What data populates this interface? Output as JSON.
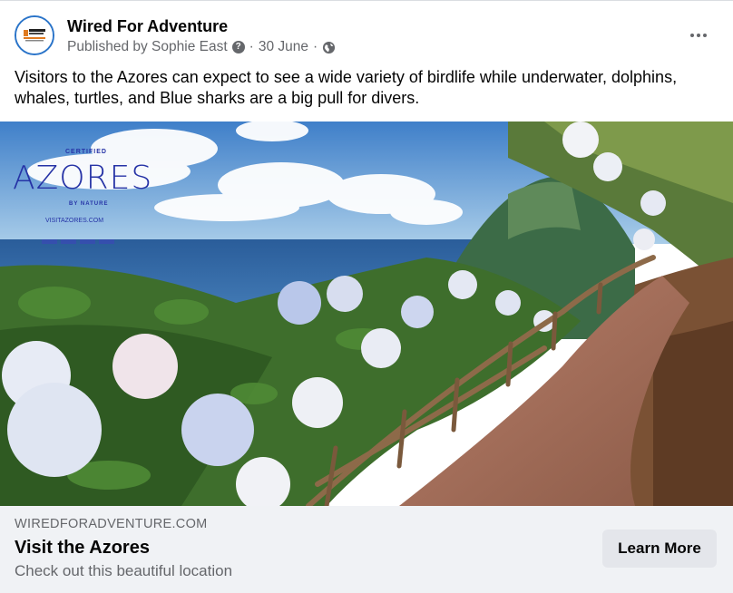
{
  "post": {
    "page_name": "Wired For Adventure",
    "published_by": "Published by Sophie East",
    "separator": "·",
    "date": "30 June",
    "caption": "Visitors to the Azores can expect to see a wide variety of birdlife while underwater, dolphins, whales, turtles, and Blue sharks are a big pull for divers.",
    "icons": {
      "help": "question-circle-icon",
      "privacy": "globe-icon",
      "more": "more-horizontal-icon"
    }
  },
  "image_overlay": {
    "certified": "CERTIFIED",
    "title": "AZORES",
    "by_nature": "BY NATURE",
    "url": "VISITAZORES.COM"
  },
  "link_preview": {
    "domain": "WIREDFORADVENTURE.COM",
    "title": "Visit the Azores",
    "description": "Check out this beautiful location",
    "cta_label": "Learn More"
  },
  "colors": {
    "text_primary": "#050505",
    "text_secondary": "#65676b",
    "footer_bg": "#f0f2f5",
    "button_bg": "#e4e6eb",
    "logo_blue": "#2633a6"
  }
}
